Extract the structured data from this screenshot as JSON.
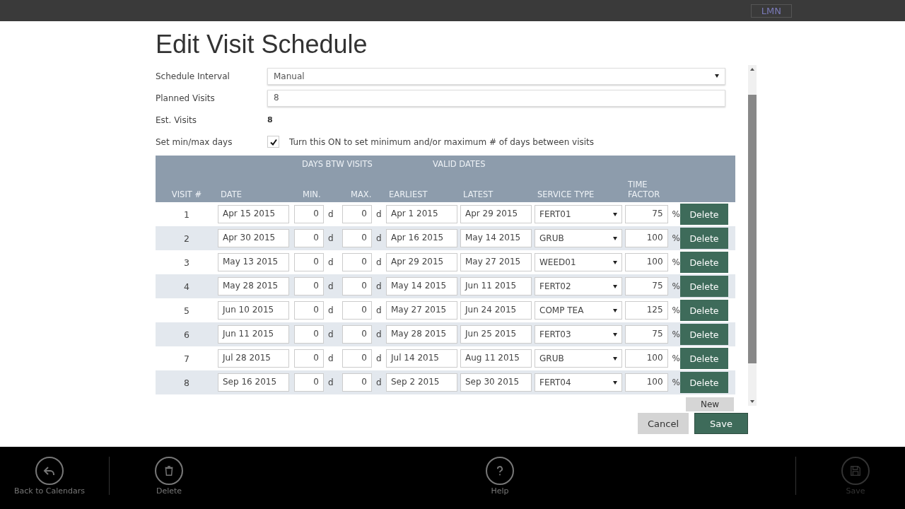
{
  "top_bar": {
    "badge": "LMN"
  },
  "dialog": {
    "title": "Edit Visit Schedule",
    "fields": [
      {
        "kind": "select",
        "label": "Schedule Interval",
        "value": "Manual"
      },
      {
        "kind": "input",
        "label": "Planned Visits",
        "value": "8"
      },
      {
        "kind": "static",
        "label": "Est. Visits",
        "value": "8"
      },
      {
        "kind": "checkbox",
        "label": "Set min/max days",
        "checked": true,
        "text": "Turn this ON to set minimum and/or maximum # of days between visits"
      }
    ],
    "table": {
      "group_headers": [
        "DAYS BTW VISITS",
        "VALID DATES"
      ],
      "columns": [
        "VISIT #",
        "DATE",
        "MIN.",
        "MAX.",
        "EARLIEST",
        "LATEST",
        "SERVICE TYPE",
        "TIME FACTOR"
      ],
      "rows": [
        {
          "visit": "1",
          "date": "Apr 15 2015",
          "min": "0",
          "min_unit": "d",
          "max": "0",
          "max_unit": "d",
          "earliest": "Apr 1 2015",
          "latest": "Apr 29 2015",
          "service": "FERT01",
          "factor": "75",
          "factor_unit": "%",
          "delete": "Delete"
        },
        {
          "visit": "2",
          "date": "Apr 30 2015",
          "min": "0",
          "min_unit": "d",
          "max": "0",
          "max_unit": "d",
          "earliest": "Apr 16 2015",
          "latest": "May 14 2015",
          "service": "GRUB",
          "factor": "100",
          "factor_unit": "%",
          "delete": "Delete"
        },
        {
          "visit": "3",
          "date": "May 13 2015",
          "min": "0",
          "min_unit": "d",
          "max": "0",
          "max_unit": "d",
          "earliest": "Apr 29 2015",
          "latest": "May 27 2015",
          "service": "WEED01",
          "factor": "100",
          "factor_unit": "%",
          "delete": "Delete"
        },
        {
          "visit": "4",
          "date": "May 28 2015",
          "min": "0",
          "min_unit": "d",
          "max": "0",
          "max_unit": "d",
          "earliest": "May 14 2015",
          "latest": "Jun 11 2015",
          "service": "FERT02",
          "factor": "75",
          "factor_unit": "%",
          "delete": "Delete"
        },
        {
          "visit": "5",
          "date": "Jun 10 2015",
          "min": "0",
          "min_unit": "d",
          "max": "0",
          "max_unit": "d",
          "earliest": "May 27 2015",
          "latest": "Jun 24 2015",
          "service": "COMP TEA",
          "factor": "125",
          "factor_unit": "%",
          "delete": "Delete"
        },
        {
          "visit": "6",
          "date": "Jun 11 2015",
          "min": "0",
          "min_unit": "d",
          "max": "0",
          "max_unit": "d",
          "earliest": "May 28 2015",
          "latest": "Jun 25 2015",
          "service": "FERT03",
          "factor": "75",
          "factor_unit": "%",
          "delete": "Delete"
        },
        {
          "visit": "7",
          "date": "Jul 28 2015",
          "min": "0",
          "min_unit": "d",
          "max": "0",
          "max_unit": "d",
          "earliest": "Jul 14 2015",
          "latest": "Aug 11 2015",
          "service": "GRUB",
          "factor": "100",
          "factor_unit": "%",
          "delete": "Delete"
        },
        {
          "visit": "8",
          "date": "Sep 16 2015",
          "min": "0",
          "min_unit": "d",
          "max": "0",
          "max_unit": "d",
          "earliest": "Sep 2 2015",
          "latest": "Sep 30 2015",
          "service": "FERT04",
          "factor": "100",
          "factor_unit": "%",
          "delete": "Delete"
        }
      ],
      "new_label": "New"
    },
    "buttons": [
      {
        "kind": "cancel",
        "label": "Cancel"
      },
      {
        "kind": "save",
        "label": "Save"
      }
    ]
  },
  "app_bar": [
    {
      "kind": "back",
      "label": "Back to Calendars",
      "disabled": false
    },
    {
      "kind": "delete",
      "label": "Delete",
      "disabled": false
    },
    {
      "kind": "help",
      "label": "Help",
      "disabled": false
    },
    {
      "kind": "save",
      "label": "Save",
      "disabled": true
    }
  ]
}
